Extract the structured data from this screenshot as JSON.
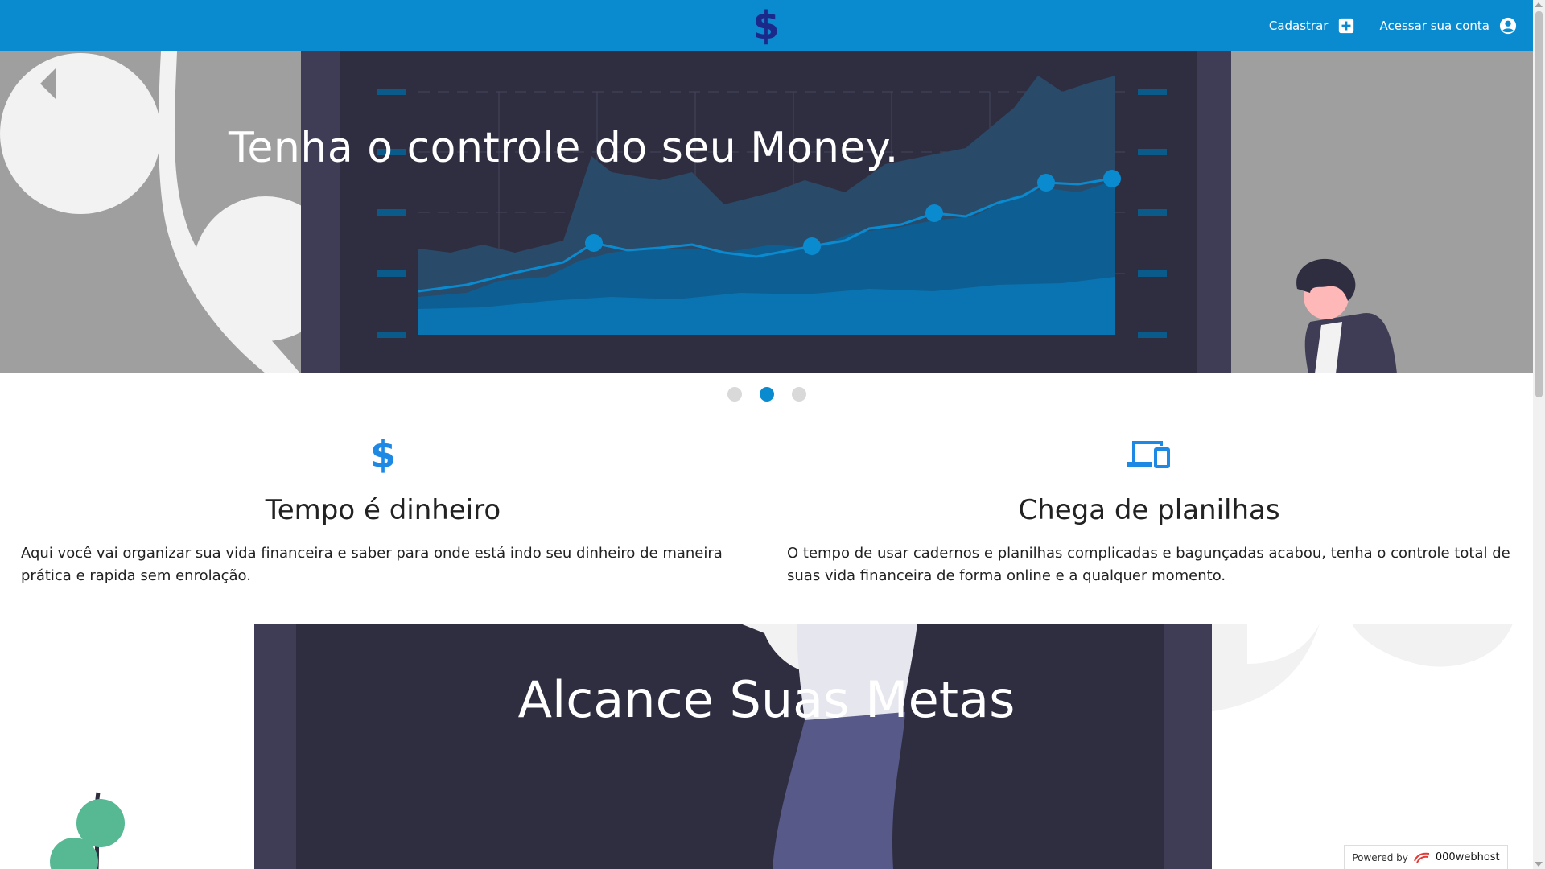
{
  "header": {
    "logo_symbol": "$",
    "nav": [
      {
        "label": "Cadastrar",
        "icon": "plus-square-icon"
      },
      {
        "label": "Acessar sua conta",
        "icon": "user-circle-icon"
      }
    ]
  },
  "hero": {
    "title": "Tenha o controle do seu Money.",
    "slides": 3,
    "active_slide": 2
  },
  "features": [
    {
      "icon": "dollar-icon",
      "icon_symbol": "$",
      "title": "Tempo é dinheiro",
      "text": "Aqui você vai organizar sua vida financeira e saber para onde está indo seu dinheiro de maneira prática e rapida sem enrolação."
    },
    {
      "icon": "devices-icon",
      "title": "Chega de planilhas",
      "text": "O tempo de usar cadernos e planilhas complicadas e bagunçadas acabou, tenha o controle total de suas vida financeira de forma online e a qualquer momento."
    }
  ],
  "goals": {
    "title": "Alcance Suas Metas"
  },
  "footer": {
    "powered_label": "Powered by",
    "powered_brand": "000webhost"
  },
  "colors": {
    "header": "#0a8bd0",
    "accent": "#1e88e5",
    "dark_screen": "#2f2e41"
  }
}
